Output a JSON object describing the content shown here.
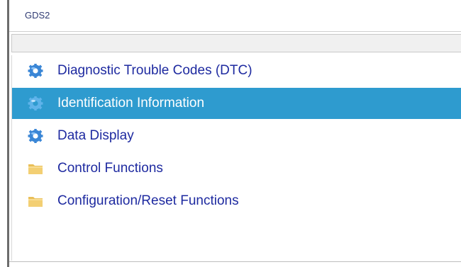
{
  "window": {
    "title": "GDS2"
  },
  "tree": {
    "items": [
      {
        "label": "Diagnostic Trouble Codes (DTC)",
        "icon": "gear-icon",
        "selected": false
      },
      {
        "label": "Identification Information",
        "icon": "gear-icon",
        "selected": true
      },
      {
        "label": "Data Display",
        "icon": "gear-icon",
        "selected": false
      },
      {
        "label": "Control Functions",
        "icon": "folder-icon",
        "selected": false
      },
      {
        "label": "Configuration/Reset Functions",
        "icon": "folder-icon",
        "selected": false
      }
    ]
  },
  "colors": {
    "selection": "#2e9bcf",
    "item_text": "#1e2aa0",
    "gear": "#3a86d6",
    "folder": "#f3cf73"
  }
}
